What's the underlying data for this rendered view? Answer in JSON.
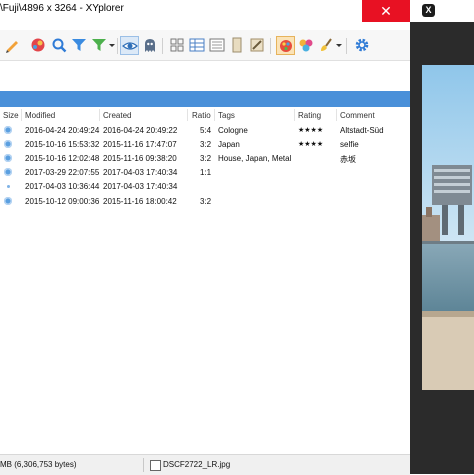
{
  "window": {
    "title": "\\Fuji\\4896 x 3264 - XYplorer",
    "close_glyph": "✕"
  },
  "toolbar": {
    "icons": [
      "pencil-icon",
      "color-ball-icon",
      "search-icon",
      "filter-icon",
      "green-filter-icon",
      "dropdown-arrow-icon",
      "eye-icon",
      "ghost-icon",
      "tiles-view-icon",
      "details-view-icon",
      "list-view-icon",
      "document-icon",
      "tools-icon",
      "palette-icon",
      "colors-icon",
      "brush-icon",
      "dropdown-arrow-icon",
      "settings-gear-icon"
    ]
  },
  "file_list": {
    "columns": [
      "Size",
      "Modified",
      "Created",
      "Ratio",
      "Tags",
      "Rating",
      "Comment"
    ],
    "rows": [
      {
        "modified": "2016-04-24 20:49:24",
        "created": "2016-04-24 20:49:22",
        "ratio": "5:4",
        "tags": "Cologne",
        "rating": "★★★★",
        "comment": "Altstadt-Süd"
      },
      {
        "modified": "2015-10-16 15:53:32",
        "created": "2015-11-16 17:47:07",
        "ratio": "3:2",
        "tags": "Japan",
        "rating": "★★★★",
        "comment": "selfie"
      },
      {
        "modified": "2015-10-16 12:02:48",
        "created": "2015-11-16 09:38:20",
        "ratio": "3:2",
        "tags": "House, Japan, Metal",
        "rating": "",
        "comment": "赤坂"
      },
      {
        "modified": "2017-03-29 22:07:55",
        "created": "2017-04-03 17:40:34",
        "ratio": "1:1",
        "tags": "",
        "rating": "",
        "comment": ""
      },
      {
        "modified": "2017-04-03 10:36:44",
        "created": "2017-04-03 17:40:34",
        "ratio": "",
        "tags": "",
        "rating": "",
        "comment": ""
      },
      {
        "modified": "2015-10-12 09:00:36",
        "created": "2015-11-16 18:00:42",
        "ratio": "3:2",
        "tags": "",
        "rating": "",
        "comment": ""
      }
    ]
  },
  "status_bar": {
    "size_text": "MB (6,306,753 bytes)",
    "filename": "DSCF2722_LR.jpg"
  },
  "preview": {
    "logo_text": "X"
  },
  "colors": {
    "accent_blue": "#4a90d9",
    "close_red": "#e81123",
    "preview_frame": "#2b2b2b"
  }
}
